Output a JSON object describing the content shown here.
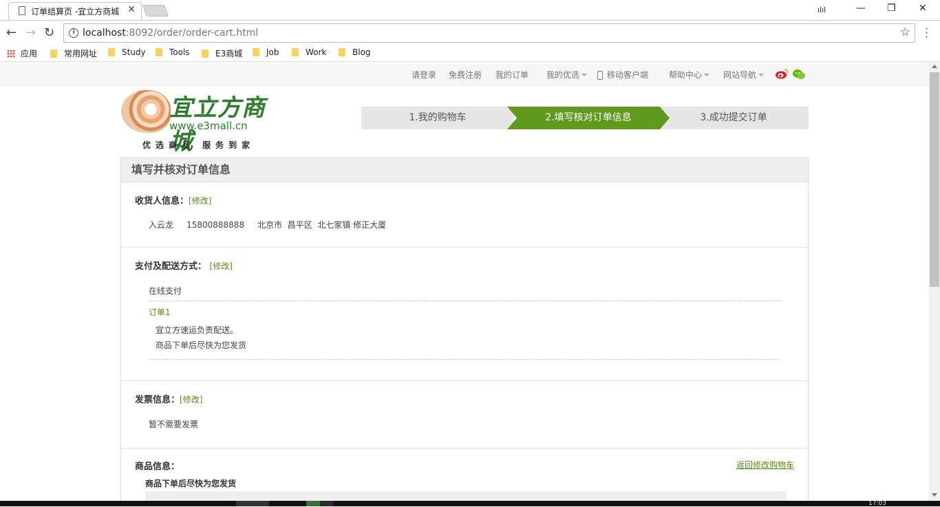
{
  "browser": {
    "tab_title": "订单结算页 -宜立方商城",
    "tab_close": "✕",
    "url_host": "localhost",
    "url_rest": ":8092/order/order-cart.html",
    "window_controls": {
      "extension": "ılıl",
      "minimize": "—",
      "restore": "❐",
      "close": "✕"
    },
    "nav": {
      "back": "←",
      "forward": "→",
      "reload": "↻"
    },
    "star": "☆",
    "bookmarks": [
      {
        "label": "应用",
        "icon": "apps-icon"
      },
      {
        "label": "常用网址",
        "icon": "folder-icon"
      },
      {
        "label": "Study",
        "icon": "folder-icon"
      },
      {
        "label": "Tools",
        "icon": "folder-icon"
      },
      {
        "label": "E3商城",
        "icon": "folder-icon"
      },
      {
        "label": "Job",
        "icon": "folder-icon"
      },
      {
        "label": "Work",
        "icon": "folder-icon"
      },
      {
        "label": "Blog",
        "icon": "folder-icon"
      }
    ]
  },
  "topnav": {
    "login": "请登录",
    "register": "免费注册",
    "my_orders": "我的订单",
    "my_favorites": "我的优选",
    "mobile": "移动客户端",
    "help": "帮助中心",
    "site_nav": "网站导航"
  },
  "logo": {
    "brand": "宜立方商城",
    "site": "www.e3mall.cn",
    "slogan": "优选商品  服务到家"
  },
  "steps": [
    {
      "label": "1.我的购物车",
      "active": false
    },
    {
      "label": "2.填写核对订单信息",
      "active": true
    },
    {
      "label": "3.成功提交订单",
      "active": false
    }
  ],
  "order": {
    "heading": "填写并核对订单信息",
    "edit_label": "[修改]",
    "receiver": {
      "title": "收货人信息：",
      "name": "入云龙",
      "phone": "15800888888",
      "address": "北京市  昌平区  北七家镇 修正大厦"
    },
    "payment": {
      "title": "支付及配送方式：",
      "method": "在线支付",
      "order_label": "订单1",
      "delivery": "宜立方速运负责配送。",
      "ship_note": "商品下单后尽快为您发货"
    },
    "invoice": {
      "title": "发票信息：",
      "value": "暂不需要发票"
    },
    "goods": {
      "title": "商品信息：",
      "back_link": "返回修改购物车",
      "note": "商品下单后尽快为您发货"
    }
  },
  "taskbar": {
    "clock": "17:03"
  },
  "colors": {
    "accent_green": "#5f9a1e",
    "link_green": "#5a8a1a"
  }
}
